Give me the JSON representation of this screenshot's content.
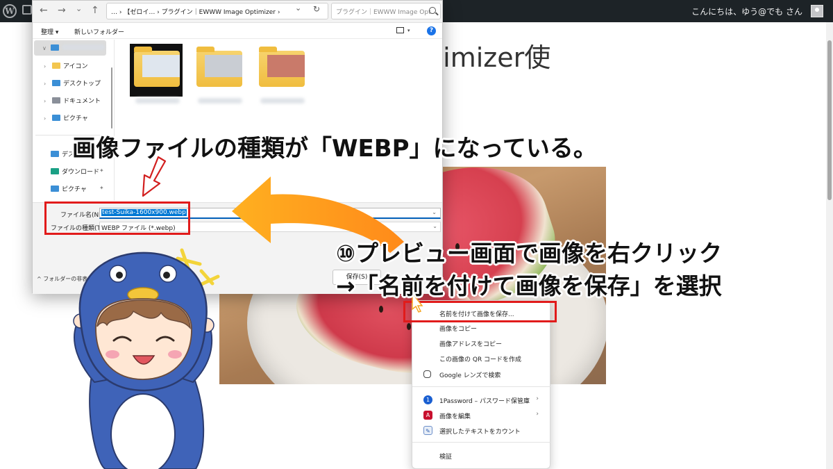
{
  "wp_bar": {
    "greeting": "こんにちは、ゆう@でも さん"
  },
  "page": {
    "title_fragment": "otimizer使"
  },
  "dialog": {
    "nav": {
      "back": "←",
      "forward": "→",
      "recent": "⌄",
      "up": "↑",
      "address": "… › 【ゼロイ… › プラグイン｜EWWW Image Optimizer ›",
      "address_chevron": "⌄",
      "refresh": "↻",
      "search_placeholder": "プラグイン｜EWWW Image Opt..."
    },
    "toolbar": {
      "organize": "整理 ▾",
      "new_folder": "新しいフォルダー",
      "help": "?"
    },
    "nav_pane": {
      "items": [
        {
          "label": "アイコン"
        },
        {
          "label": "デスクトップ"
        },
        {
          "label": "ドキュメント"
        },
        {
          "label": "ピクチャ"
        }
      ],
      "quick": [
        {
          "label": "デスク"
        },
        {
          "label": "ダウンロード"
        },
        {
          "label": "ピクチャ"
        }
      ]
    },
    "filename_label": "ファイル名(N):",
    "filename_value": "test-Suika-1600x900.webp",
    "filetype_label": "ファイルの種類(T):",
    "filetype_value": "WEBP ファイル (*.webp)",
    "hide_folders": "^ フォルダーの非表示",
    "save_button": "保存(S)"
  },
  "context_menu": {
    "items": [
      {
        "label": "名前を付けて画像を保存..."
      },
      {
        "label": "画像をコピー"
      },
      {
        "label": "画像アドレスをコピー"
      },
      {
        "label": "この画像の QR コードを作成"
      },
      {
        "label": "Google レンズで検索",
        "icon": "lens-icon"
      },
      {
        "label": "1Password – パスワード保管庫",
        "icon": "onepassword-icon",
        "submenu": "›"
      },
      {
        "label": "画像を編集",
        "icon": "acrobat-icon",
        "submenu": "›"
      },
      {
        "label": "選択したテキストをカウント",
        "icon": "count-icon"
      },
      {
        "label": "検証"
      }
    ]
  },
  "annotations": {
    "caption_top": "画像ファイルの種類が「WEBP」になっている。",
    "caption_step_line1": "⑩プレビュー画面で画像を右クリック",
    "caption_step_line2": "→「名前を付けて画像を保存」を選択"
  },
  "colors": {
    "highlight": "#e11b1b",
    "arrow": "#f5a623",
    "wp_bar": "#1d2327",
    "selection": "#0078d4"
  }
}
